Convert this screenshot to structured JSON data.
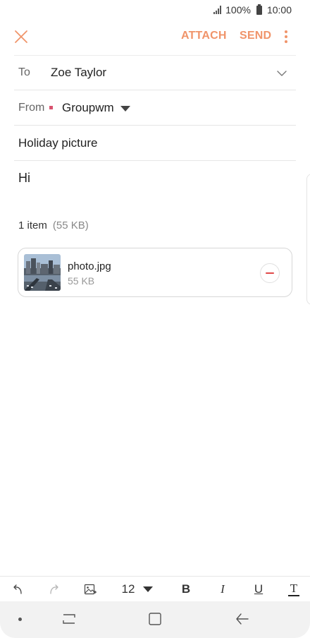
{
  "status_bar": {
    "battery_percent": "100%",
    "time": "10:00",
    "signal_icon": "signal-icon",
    "battery_icon": "battery-icon"
  },
  "app_bar": {
    "close_icon": "close-icon",
    "attach_label": "ATTACH",
    "send_label": "SEND",
    "more_icon": "more-vertical-icon",
    "accent_color": "#f0946a"
  },
  "compose": {
    "to_label": "To",
    "to_value": "Zoe Taylor",
    "from_label": "From",
    "from_value": "Groupwm",
    "from_account_color": "#d9536f",
    "subject": "Holiday picture",
    "body": "Hi"
  },
  "attachments": {
    "count_label": "1 item",
    "total_size": "(55 KB)",
    "items": [
      {
        "name": "photo.jpg",
        "size": "55 KB"
      }
    ]
  },
  "format_toolbar": {
    "undo_icon": "undo-icon",
    "redo_icon": "redo-icon",
    "insert_image_icon": "insert-image-icon",
    "font_size": "12",
    "bold": "B",
    "italic": "I",
    "underline": "U",
    "text_color": "T"
  },
  "nav_bar": {
    "icons": [
      "dot-icon",
      "recent-apps-icon",
      "home-icon",
      "back-icon"
    ]
  }
}
